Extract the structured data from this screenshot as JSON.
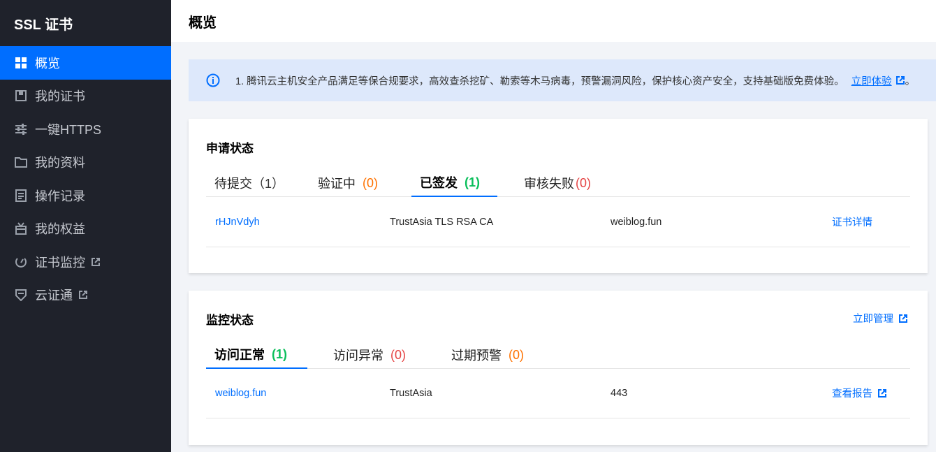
{
  "app": {
    "title": "SSL 证书"
  },
  "sidebar": {
    "items": [
      {
        "label": "概览",
        "icon": "grid-icon",
        "active": true
      },
      {
        "label": "我的证书",
        "icon": "certificate-icon"
      },
      {
        "label": "一键HTTPS",
        "icon": "sliders-icon"
      },
      {
        "label": "我的资料",
        "icon": "folder-icon"
      },
      {
        "label": "操作记录",
        "icon": "log-icon"
      },
      {
        "label": "我的权益",
        "icon": "gift-icon"
      },
      {
        "label": "证书监控",
        "icon": "monitor-icon",
        "external": true
      },
      {
        "label": "云证通",
        "icon": "shield-icon",
        "external": true
      }
    ]
  },
  "header": {
    "title": "概览"
  },
  "notice": {
    "text": "1. 腾讯云主机安全产品满足等保合规要求，高效查杀挖矿、勒索等木马病毒，预警漏洞风险，保护核心资产安全，支持基础版免费体验。",
    "link": "立即体验",
    "suffix": "。"
  },
  "application_status": {
    "title": "申请状态",
    "tabs": [
      {
        "label": "待提交",
        "count": "（1）"
      },
      {
        "label": "验证中",
        "count": "(0)"
      },
      {
        "label": "已签发",
        "count": "(1)",
        "active": true
      },
      {
        "label": "审核失败",
        "count": "(0)"
      }
    ],
    "rows": [
      {
        "id": "rHJnVdyh",
        "ca": "TrustAsia TLS RSA CA",
        "domain": "weiblog.fun",
        "action": "证书详情"
      }
    ]
  },
  "monitor_status": {
    "title": "监控状态",
    "action": "立即管理",
    "tabs": [
      {
        "label": "访问正常",
        "count": "(1)",
        "active": true
      },
      {
        "label": "访问异常",
        "count": "(0)"
      },
      {
        "label": "过期预警",
        "count": "(0)"
      }
    ],
    "rows": [
      {
        "domain": "weiblog.fun",
        "brand": "TrustAsia",
        "port": "443",
        "action": "查看报告"
      }
    ]
  },
  "colors": {
    "accent": "#006eff",
    "sidebar_bg": "#1f222b",
    "count_green": "#0abf5b",
    "count_orange": "#ff7200",
    "count_red": "#e54545",
    "notice_bg": "#dde8fb"
  }
}
